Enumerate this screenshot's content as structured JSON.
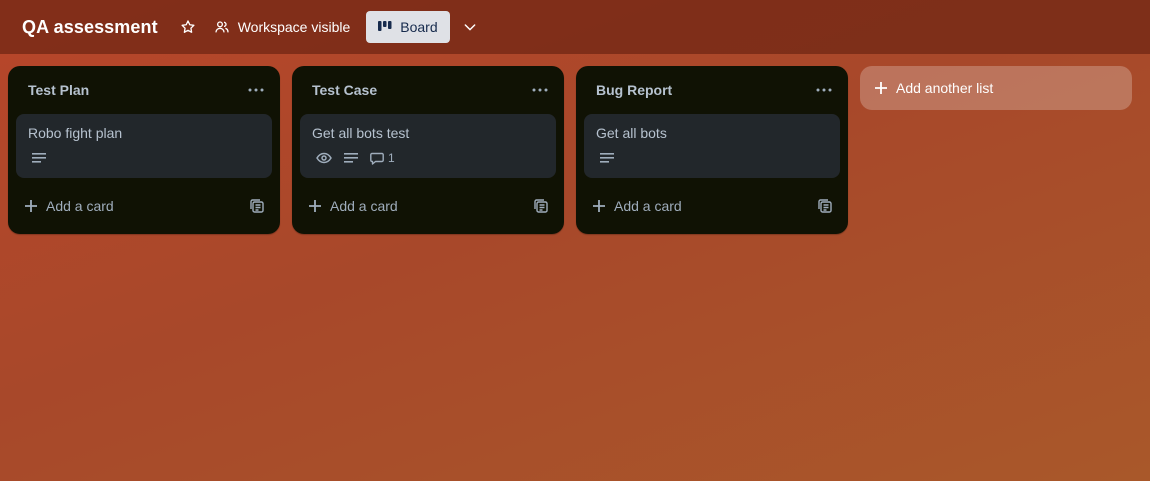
{
  "header": {
    "board_title": "QA assessment",
    "visibility_label": "Workspace visible",
    "view_label": "Board"
  },
  "lists": [
    {
      "title": "Test Plan",
      "card": {
        "title": "Robo fight plan",
        "badges": [
          "description-icon"
        ]
      },
      "add_card_label": "Add a card"
    },
    {
      "title": "Test Case",
      "card": {
        "title": "Get all bots test",
        "badges": [
          "watch-icon",
          "description-icon",
          "comment-icon"
        ],
        "comment_count": "1"
      },
      "add_card_label": "Add a card"
    },
    {
      "title": "Bug Report",
      "card": {
        "title": "Get all bots",
        "badges": [
          "description-icon"
        ]
      },
      "add_card_label": "Add a card"
    }
  ],
  "add_list_label": "Add another list",
  "colors": {
    "header_bg": "#6e2614",
    "list_bg": "#101204",
    "card_bg": "#22272b",
    "text_muted": "#9fadbc"
  }
}
